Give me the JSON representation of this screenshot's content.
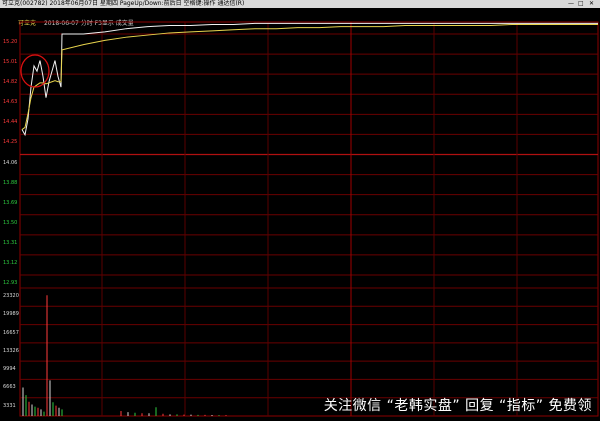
{
  "window": {
    "title": "可立克(002782)  2018年06月07日 星期四  PageUp/Down:前后日  空格键:操作 通达信(R)",
    "controls": [
      "—",
      "□",
      "✕"
    ]
  },
  "header": {
    "code": "可立克",
    "info": "2018-06-07 分时  F3显示  成交量"
  },
  "price_axis": {
    "labels": [
      "15.20",
      "15.01",
      "14.82",
      "14.63",
      "14.44",
      "14.25",
      "14.06",
      "13.88",
      "13.69",
      "13.50",
      "13.31",
      "13.12",
      "12.93"
    ],
    "colors": [
      "#ff3b3b",
      "#ff3b3b",
      "#ff3b3b",
      "#ff3b3b",
      "#ff3b3b",
      "#ff3b3b",
      "#d8d8d8",
      "#2ecc40",
      "#2ecc40",
      "#2ecc40",
      "#2ecc40",
      "#2ecc40",
      "#2ecc40"
    ]
  },
  "volume_axis": {
    "labels": [
      "23320",
      "19989",
      "16657",
      "13326",
      "9994",
      "6663",
      "3331"
    ]
  },
  "watermark": "关注微信 “老韩实盘” 回复 “指标” 免费领",
  "chart_data": {
    "type": "line",
    "price_series": {
      "y": [
        14.3,
        14.25,
        14.4,
        14.7,
        14.9,
        14.85,
        14.95,
        14.8,
        14.6,
        14.75,
        14.85,
        14.95,
        14.8,
        14.7,
        15.2,
        15.2,
        15.22,
        15.25,
        15.27,
        15.28,
        15.28,
        15.29,
        15.29,
        15.3,
        15.3,
        15.3,
        15.3,
        15.3,
        15.3,
        15.3,
        15.3,
        15.3,
        15.3,
        15.3,
        15.3,
        15.3,
        15.3,
        15.3,
        15.3,
        15.3
      ]
    },
    "avg_series": {
      "y": [
        14.3,
        14.32,
        14.45,
        14.6,
        14.7,
        14.72,
        14.74,
        14.74,
        14.73,
        14.74,
        14.75,
        14.76,
        14.75,
        14.75,
        15.05,
        15.1,
        15.14,
        15.17,
        15.19,
        15.21,
        15.22,
        15.23,
        15.24,
        15.25,
        15.25,
        15.26,
        15.26,
        15.27,
        15.27,
        15.27,
        15.28,
        15.28,
        15.28,
        15.28,
        15.28,
        15.29,
        15.29,
        15.29,
        15.29,
        15.29
      ]
    },
    "volume": [
      5200,
      3800,
      2600,
      2100,
      1700,
      1500,
      1200,
      800,
      22000,
      6500,
      2500,
      1900,
      1500,
      1200,
      900,
      700,
      600,
      500,
      500,
      1600,
      400,
      300,
      300,
      250,
      250,
      200,
      200,
      180,
      150,
      150
    ],
    "ylim_price": [
      12.93,
      15.2
    ],
    "ylim_volume": [
      0,
      23320
    ]
  }
}
